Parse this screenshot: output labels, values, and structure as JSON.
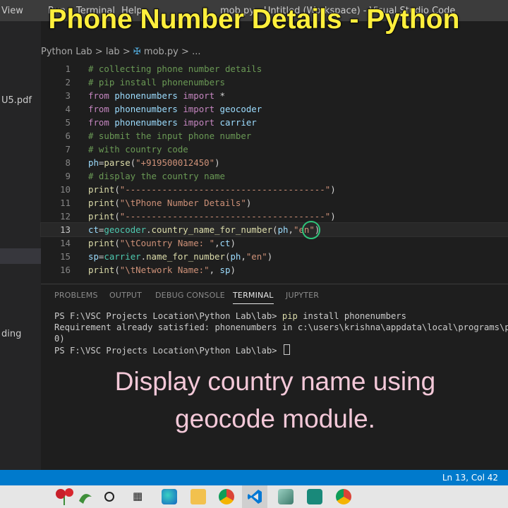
{
  "menubar": {
    "items": [
      "View",
      "Run",
      "Terminal",
      "Help"
    ],
    "window_title": "mob.py - Untitled (Workspace) - Visual Studio Code"
  },
  "video_title": "Phone Number Details - Python",
  "sidebar": {
    "items": [
      "U5.pdf",
      "ding"
    ]
  },
  "breadcrumb": {
    "parts": [
      "Python Lab",
      ">",
      "lab",
      ">",
      "mob.py",
      ">",
      "..."
    ]
  },
  "code_lines": [
    {
      "n": "1",
      "text": "# collecting phone number details"
    },
    {
      "n": "2",
      "text": "# pip install phonenumbers"
    },
    {
      "n": "3",
      "text": "from phonenumbers import *"
    },
    {
      "n": "4",
      "text": "from phonenumbers import geocoder"
    },
    {
      "n": "5",
      "text": "from phonenumbers import carrier"
    },
    {
      "n": "6",
      "text": "# submit the input phone number"
    },
    {
      "n": "7",
      "text": "# with country code"
    },
    {
      "n": "8",
      "text": "ph=parse(\"+919500012450\")"
    },
    {
      "n": "9",
      "text": "# display the country name"
    },
    {
      "n": "10",
      "text": "print(\"--------------------------------------\")"
    },
    {
      "n": "11",
      "text": "print(\"\\tPhone Number Details\")"
    },
    {
      "n": "12",
      "text": "print(\"--------------------------------------\")"
    },
    {
      "n": "13",
      "text": "ct=geocoder.country_name_for_number(ph,\"en\")"
    },
    {
      "n": "14",
      "text": "print(\"\\tCountry Name: \",ct)"
    },
    {
      "n": "15",
      "text": "sp=carrier.name_for_number(ph,\"en\")"
    },
    {
      "n": "16",
      "text": "print(\"\\tNetwork Name:\", sp)"
    }
  ],
  "panel": {
    "tabs": [
      "PROBLEMS",
      "OUTPUT",
      "DEBUG CONSOLE",
      "TERMINAL",
      "JUPYTER"
    ],
    "active_tab": "TERMINAL",
    "terminal_lines": [
      {
        "prompt": "PS F:\\VSC Projects Location\\Python Lab\\lab> ",
        "cmd": "pip",
        "rest": " install phonenumbers"
      },
      {
        "prompt": "",
        "cmd": "",
        "rest": "Requirement already satisfied: phonenumbers in c:\\users\\krishna\\appdata\\local\\programs\\p"
      },
      {
        "prompt": "",
        "cmd": "",
        "rest": "0)"
      },
      {
        "prompt": "PS F:\\VSC Projects Location\\Python Lab\\lab> ",
        "cmd": "",
        "rest": ""
      }
    ]
  },
  "caption": {
    "line1": "Display country name using",
    "line2": "geocode module."
  },
  "statusbar": {
    "position": "Ln 13, Col 42"
  },
  "colors": {
    "title": "#ffef3c",
    "caption": "#f3c8d8",
    "statusbar": "#007acc",
    "accent_ring": "#2fc47a"
  }
}
